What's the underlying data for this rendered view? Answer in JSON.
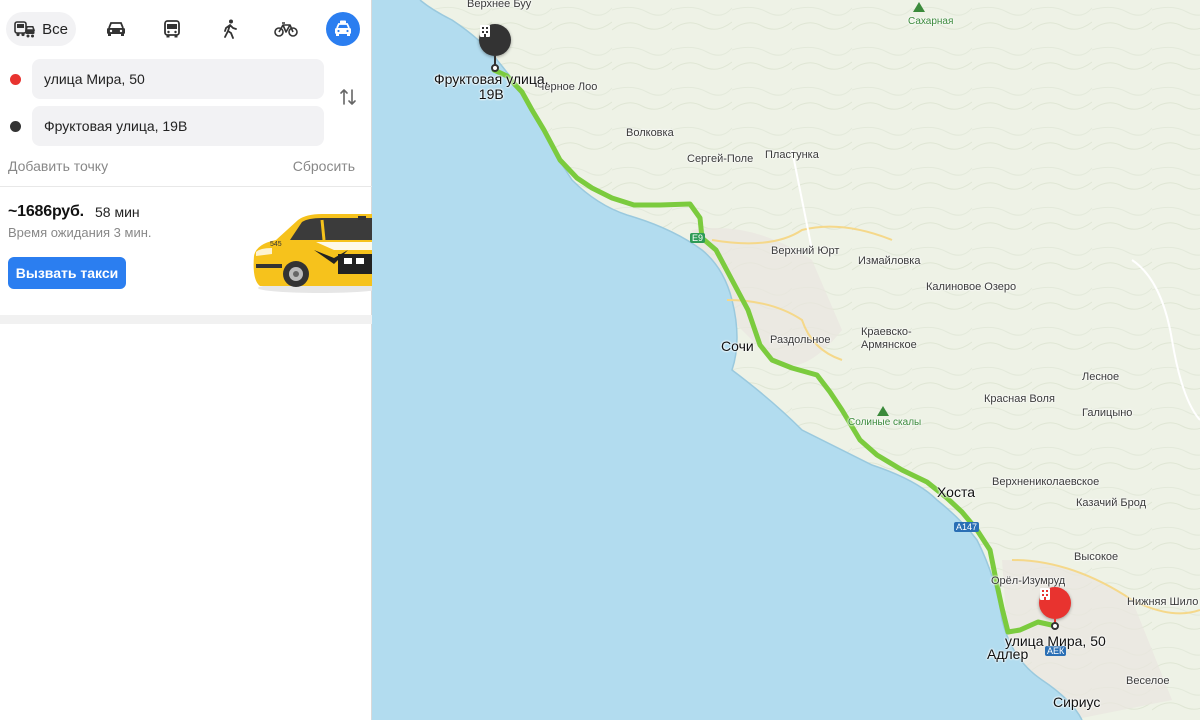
{
  "modes": {
    "all_label": "Все",
    "items": [
      "car-icon",
      "bus-icon",
      "walk-icon",
      "bike-icon",
      "taxi-icon"
    ],
    "active": "taxi"
  },
  "route": {
    "from": "улица Мира, 50",
    "to": "Фруктовая улица, 19В",
    "add_point": "Добавить точку",
    "reset": "Сбросить"
  },
  "taxi": {
    "price": "~1686руб.",
    "duration": "58 мин",
    "wait": "Время ожидания 3 мин.",
    "call_button": "Вызвать такси"
  },
  "colors": {
    "accent": "#2b7ef0",
    "route": "#7bcb3e",
    "sea": "#b2dcef",
    "land": "#eef2e6",
    "start_pin": "#333333",
    "end_pin": "#e8332f"
  },
  "map": {
    "places": {
      "verkhnee_buu": "Верхнее Буу",
      "sakharnaya": "Сахарная",
      "chernoe_loo": "Черное Лоо",
      "volkovka": "Волковка",
      "sergey_pole": "Сергей-Поле",
      "plastunka": "Пластунка",
      "verkhniy_yurt": "Верхний Юрт",
      "izmaylovka": "Измайловка",
      "kalinovoe_ozero": "Калиновое Озеро",
      "sochi": "Сочи",
      "razdolnoe": "Раздольное",
      "kraevsko_armyanskoe_1": "Краевско-",
      "kraevsko_armyanskoe_2": "Армянское",
      "lesnoe": "Лесное",
      "krasnaya_volya": "Красная Воля",
      "galitsyno": "Галицыно",
      "solnye_skaly": "Солиные скалы",
      "khosta": "Хоста",
      "verkhnenikolaevskoe": "Верхнениколаевское",
      "kazachiy_brod": "Казачий Брод",
      "vysokoe": "Высокое",
      "orel_izumrud": "Орёл-Изумруд",
      "nizhnyaya_shilovka": "Нижняя Шило",
      "adler": "Адлер",
      "veseloe": "Веселое",
      "sirius": "Сириус"
    },
    "start_label_1": "Фруктовая улица,",
    "start_label_2": "19В",
    "end_label": "улица Мира, 50",
    "road_badges": [
      "E9",
      "А147",
      "АЕК"
    ]
  }
}
